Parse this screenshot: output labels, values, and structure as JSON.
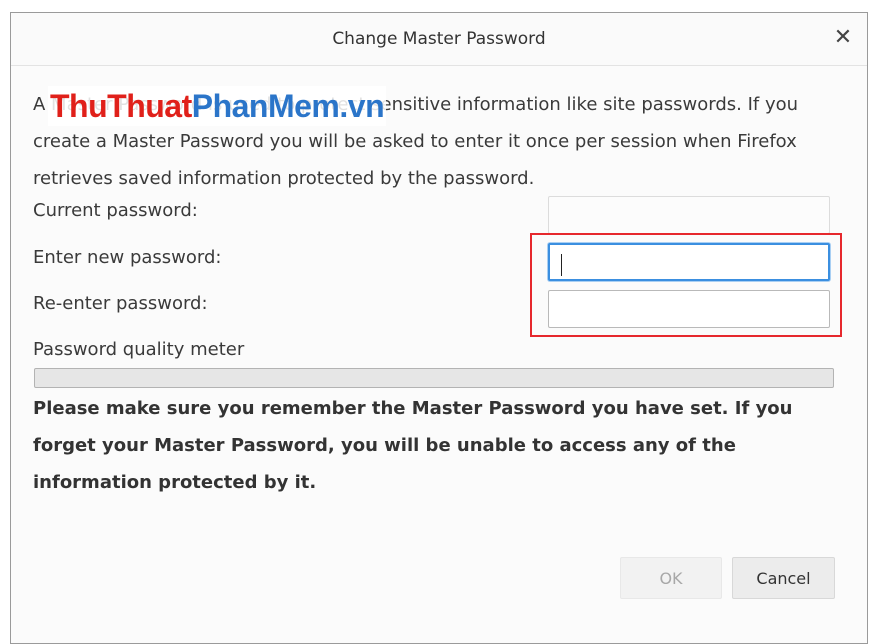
{
  "dialog": {
    "title": "Change Master Password",
    "close_glyph": "✕"
  },
  "intro": {
    "text": "A Master Password is used to protect sensitive information like site passwords. If you create a Master Password you will be asked to enter it once per session when Firefox retrieves saved information protected by the password."
  },
  "watermark": {
    "part1": "ThuThuat",
    "part2": "PhanMem",
    "part3": ".vn"
  },
  "fields": {
    "current_label": "Current password:",
    "current_value": "",
    "new_label": "Enter new password:",
    "new_value": "",
    "reenter_label": "Re-enter password:",
    "reenter_value": ""
  },
  "meter": {
    "label": "Password quality meter",
    "level": 0
  },
  "warning": {
    "text": "Please make sure you remember the Master Password you have set. If you forget your Master Password, you will be unable to access any of the information protected by it."
  },
  "buttons": {
    "ok_label": "OK",
    "cancel_label": "Cancel"
  },
  "colors": {
    "highlight": "#e6282d",
    "focus": "#3b8fe0",
    "watermark_red": "#e0201a",
    "watermark_blue": "#2b75c9"
  }
}
